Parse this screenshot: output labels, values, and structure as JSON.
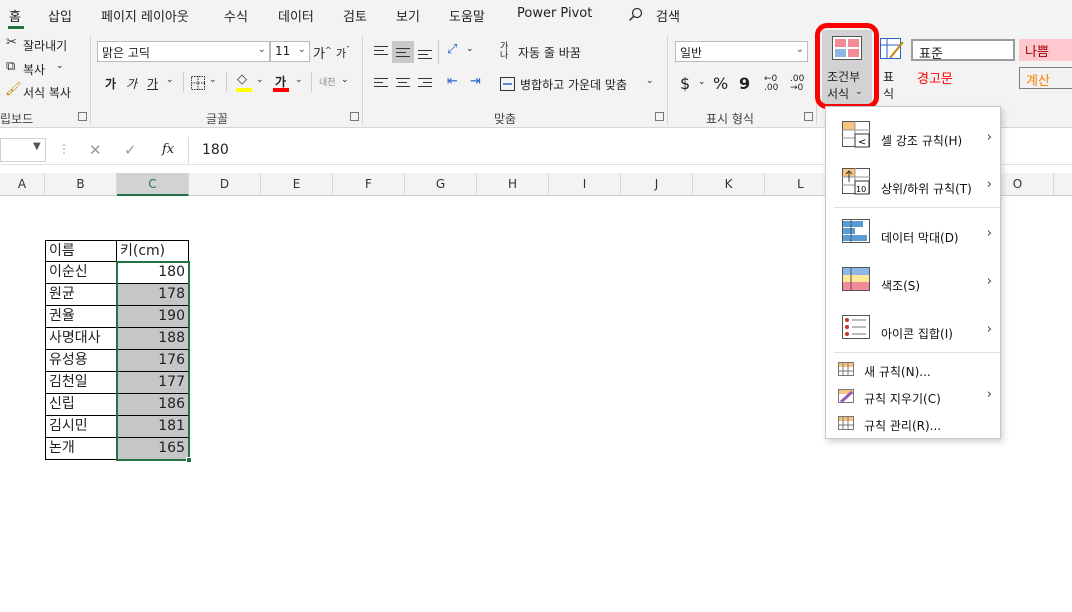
{
  "menu": {
    "tabs": [
      "홈",
      "삽입",
      "페이지 레이아웃",
      "수식",
      "데이터",
      "검토",
      "보기",
      "도움말",
      "Power Pivot"
    ],
    "search_label": "검색"
  },
  "clipboard": {
    "cut": "잘라내기",
    "copy": "복사",
    "format_painter": "서식 복사",
    "group_label": "립보드"
  },
  "font": {
    "name": "맑은 고딕",
    "size": "11",
    "group_label": "글꼴",
    "bold": "가",
    "italic": "가",
    "underline": "가",
    "color_glyph": "가",
    "phonetic": "내천"
  },
  "alignment": {
    "wrap": "자동 줄 바꿈",
    "merge": "병합하고 가운데 맞춤",
    "group_label": "맞춤"
  },
  "number": {
    "format": "일반",
    "currency": "$",
    "percent": "%",
    "comma": "9",
    "group_label": "표시 형식"
  },
  "conditional_format": {
    "label_line1": "조건부",
    "label_line2": "서식",
    "table_label_line1": "표",
    "table_label_line2": "식"
  },
  "styles": {
    "normal": "표준",
    "bad": "나쁨",
    "warning": "경고문",
    "calc": "계산"
  },
  "formula_bar": {
    "fx": "fx",
    "value": "180"
  },
  "columns": [
    "A",
    "B",
    "C",
    "D",
    "E",
    "F",
    "G",
    "H",
    "I",
    "J",
    "K",
    "L",
    "O"
  ],
  "table": {
    "header": [
      "이름",
      "키(cm)"
    ],
    "rows": [
      {
        "name": "이순신",
        "height": "180"
      },
      {
        "name": "원균",
        "height": "178"
      },
      {
        "name": "권율",
        "height": "190"
      },
      {
        "name": "사명대사",
        "height": "188"
      },
      {
        "name": "유성용",
        "height": "176"
      },
      {
        "name": "김천일",
        "height": "177"
      },
      {
        "name": "신립",
        "height": "186"
      },
      {
        "name": "김시민",
        "height": "181"
      },
      {
        "name": "논개",
        "height": "165"
      }
    ]
  },
  "cf_menu": {
    "highlight": "셀 강조 규칙(H)",
    "topbottom": "상위/하위 규칙(T)",
    "databar": "데이터 막대(D)",
    "colorscale": "색조(S)",
    "iconset": "아이콘 집합(I)",
    "new_rule": "새 규칙(N)...",
    "clear_rules": "규칙 지우기(C)",
    "manage_rules": "규칙 관리(R)..."
  },
  "colors": {
    "accent": "#217346",
    "highlight_ring": "#ff0000",
    "selection_fill": "#c6c6c6",
    "bad_bg": "#ffc7ce",
    "bad_fg": "#9c0006",
    "calc_fg": "#fa7d00",
    "warning_fg": "#ff0000"
  }
}
